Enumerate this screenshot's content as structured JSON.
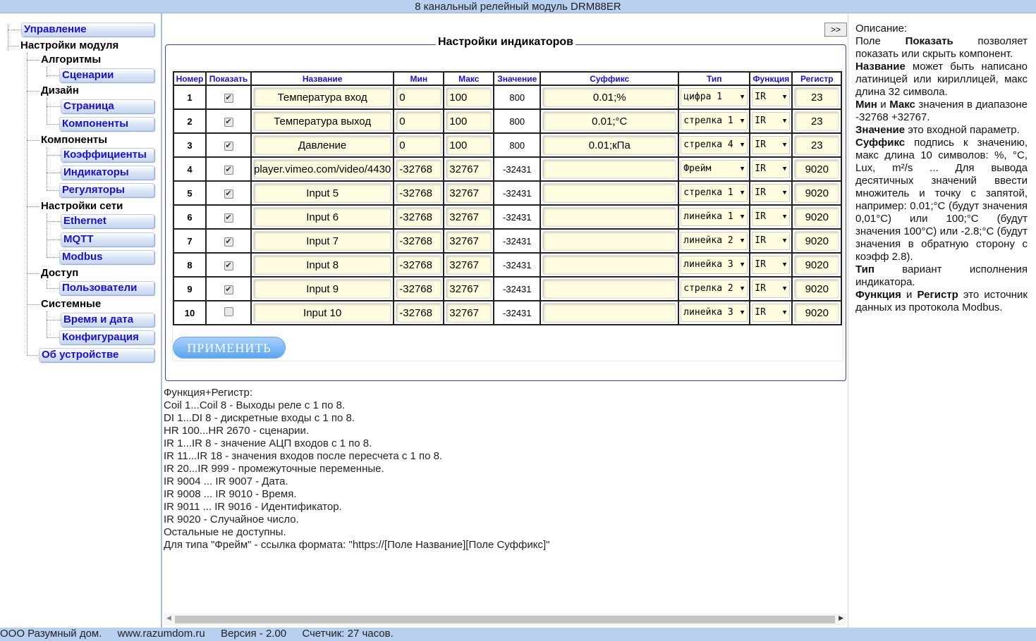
{
  "title": "8 канальный релейный модуль DRM88ER",
  "sidebar": {
    "items": [
      {
        "label": "Управление",
        "type": "link"
      },
      {
        "label": "Настройки модуля",
        "type": "head"
      },
      {
        "label": "Алгоритмы",
        "type": "head"
      },
      {
        "label": "Сценарии",
        "type": "link"
      },
      {
        "label": "Дизайн",
        "type": "head"
      },
      {
        "label": "Страница",
        "type": "link"
      },
      {
        "label": "Компоненты",
        "type": "link"
      },
      {
        "label": "Компоненты",
        "type": "head"
      },
      {
        "label": "Коэффициенты",
        "type": "link"
      },
      {
        "label": "Индикаторы",
        "type": "link"
      },
      {
        "label": "Регуляторы",
        "type": "link"
      },
      {
        "label": "Настройки сети",
        "type": "head"
      },
      {
        "label": "Ethernet",
        "type": "link"
      },
      {
        "label": "MQTT",
        "type": "link"
      },
      {
        "label": "Modbus",
        "type": "link"
      },
      {
        "label": "Доступ",
        "type": "head"
      },
      {
        "label": "Пользователи",
        "type": "link"
      },
      {
        "label": "Системные",
        "type": "head"
      },
      {
        "label": "Время и дата",
        "type": "link"
      },
      {
        "label": "Конфигурация",
        "type": "link"
      },
      {
        "label": "Об устройстве",
        "type": "link"
      }
    ]
  },
  "main": {
    "toggle_label": ">>",
    "panel_title": "Настройки индикаторов",
    "columns": [
      "Номер",
      "Показать",
      "Название",
      "Мин",
      "Макс",
      "Значение",
      "Суффикс",
      "Тип",
      "Функция",
      "Регистр"
    ],
    "rows": [
      {
        "num": "1",
        "show": true,
        "name": "Температура вход",
        "min": "0",
        "max": "100",
        "value": "800",
        "suffix": "0.01;%",
        "type": "цифра  1",
        "func": "IR",
        "reg": "23"
      },
      {
        "num": "2",
        "show": true,
        "name": "Температура выход",
        "min": "0",
        "max": "100",
        "value": "800",
        "suffix": "0.01;°C",
        "type": "стрелка  1",
        "func": "IR",
        "reg": "23"
      },
      {
        "num": "3",
        "show": true,
        "name": "Давление",
        "min": "0",
        "max": "100",
        "value": "800",
        "suffix": "0.01;кПа",
        "type": "стрелка  4",
        "func": "IR",
        "reg": "23"
      },
      {
        "num": "4",
        "show": true,
        "name": "player.vimeo.com/video/4430",
        "min": "-32768",
        "max": "32767",
        "value": "-32431",
        "suffix": "",
        "type": "Фрейм",
        "func": "IR",
        "reg": "9020"
      },
      {
        "num": "5",
        "show": true,
        "name": "Input 5",
        "min": "-32768",
        "max": "32767",
        "value": "-32431",
        "suffix": "",
        "type": "стрелка  1",
        "func": "IR",
        "reg": "9020"
      },
      {
        "num": "6",
        "show": true,
        "name": "Input 6",
        "min": "-32768",
        "max": "32767",
        "value": "-32431",
        "suffix": "",
        "type": "линейка  1",
        "func": "IR",
        "reg": "9020"
      },
      {
        "num": "7",
        "show": true,
        "name": "Input 7",
        "min": "-32768",
        "max": "32767",
        "value": "-32431",
        "suffix": "",
        "type": "линейка  2",
        "func": "IR",
        "reg": "9020"
      },
      {
        "num": "8",
        "show": true,
        "name": "Input 8",
        "min": "-32768",
        "max": "32767",
        "value": "-32431",
        "suffix": "",
        "type": "линейка  3",
        "func": "IR",
        "reg": "9020"
      },
      {
        "num": "9",
        "show": true,
        "name": "Input 9",
        "min": "-32768",
        "max": "32767",
        "value": "-32431",
        "suffix": "",
        "type": "стрелка  2",
        "func": "IR",
        "reg": "9020"
      },
      {
        "num": "10",
        "show": false,
        "name": "Input 10",
        "min": "-32768",
        "max": "32767",
        "value": "-32431",
        "suffix": "",
        "type": "линейка  3",
        "func": "IR",
        "reg": "9020"
      }
    ],
    "apply_label": "ПРИМЕНИТЬ",
    "notes": [
      "Функция+Регистр:",
      "Coil 1...Coil 8 - Выходы реле с 1 по 8.",
      "DI 1...DI 8 - дискретные входы с 1 по 8.",
      "HR 100...HR 2670 - сценарии.",
      "IR 1...IR 8 - значение АЦП входов с 1 по 8.",
      "IR 11...IR 18 - значения входов после пересчета с 1 по 8.",
      "IR 20...IR 999 - промежуточные переменные.",
      "IR 9004 ... IR 9007 - Дата.",
      "IR 9008 ... IR 9010 - Время.",
      "IR 9011 ... IR 9016 - Идентификатор.",
      "IR 9020 - Случайное число.",
      "Остальные не доступны.",
      "Для типа \"Фрейм\" - ссылка формата: \"https://[Поле Название][Поле Суффикс]\""
    ]
  },
  "description": {
    "heading": "Описание:",
    "p1_pre": "Поле ",
    "p1_bold": "Показать",
    "p1_post": " позволяет показать или скрыть компонент.",
    "p2_bold": "Название",
    "p2_post": " может быть написано латиницей или кириллицей, макс длина 32 символа.",
    "p3_bold1": "Мин",
    "p3_mid": " и ",
    "p3_bold2": "Макс",
    "p3_post": " значения в диапазоне -32768 +32767.",
    "p4_bold": "Значение",
    "p4_post": " это входной параметр.",
    "p5_bold": "Суффикс",
    "p5_post": " подпись к значению, макс длина 10 символов: %, °C, Lux, m²/s ... Для вывода десятичных значений ввести множитель и точку с запятой, например: 0.01;°C (будут значения 0,01°C) или 100;°C (будут значения 100°C) или -2.8;°C (будут значения в обратную сторону с коэфф 2.8).",
    "p6_bold": "Тип",
    "p6_post": " вариант исполнения индикатора.",
    "p7_bold1": "Функция",
    "p7_mid": " и ",
    "p7_bold2": "Регистр",
    "p7_post": " это источник данных из протокола Modbus."
  },
  "footer": {
    "company": "ООО Разумный дом.",
    "site": "www.razumdom.ru",
    "version": "Версия - 2.00",
    "counter": "Счетчик: 27 часов."
  },
  "colors": {
    "link": "#1b10d6",
    "bar": "#b8cff0",
    "accent": "#5aa6f0",
    "input_bg": "#fffce0"
  }
}
